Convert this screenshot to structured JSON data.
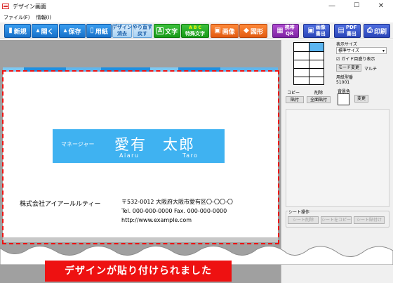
{
  "window": {
    "title": "デザイン画面",
    "minimize": "—",
    "maximize": "☐",
    "close": "✕"
  },
  "menu": [
    "ファイル(F)",
    "情報(I)"
  ],
  "toolbar": {
    "new": "新規",
    "open": "開く",
    "save": "保存",
    "paper": "用紙",
    "design_clear": [
      "デザイン",
      "消去"
    ],
    "undo_redo": [
      "やり直す",
      "戻す"
    ],
    "text": "文字",
    "special_text": [
      "特殊文字"
    ],
    "image": "画像",
    "shape": "図形",
    "mobile_qr": [
      "携帯",
      "QR"
    ],
    "image_out": [
      "画像",
      "書出"
    ],
    "pdf_out": [
      "PDF",
      "書出"
    ],
    "print": "印刷"
  },
  "card": {
    "role": "マネージャー",
    "name": "愛有　太郎",
    "romaji_first": "Aiaru",
    "romaji_last": "Taro",
    "company": "株式会社アイアールルティー",
    "address": "〒532-0012  大阪府大阪市愛有区〇-〇〇-〇",
    "phone": "Tel. 000-000-0000  Fax. 000-000-0000",
    "url": "http://www.example.com"
  },
  "panel": {
    "display_size_label": "表示サイズ",
    "display_size_value": "標準サイズ",
    "guide_checkbox": "ガイド目盛り表示",
    "mode_button": "モード変更",
    "multi_label": "マルチ",
    "paper_number_label": "用紙型番",
    "paper_number_value": "51001",
    "copy": "コピー",
    "delete": "削除",
    "paste": "貼付",
    "paste_all": "全面貼付",
    "bg_color_label": "背景色",
    "change": "変更",
    "sheet_ops_label": "シート操作",
    "sheet_delete": "シート削除",
    "sheet_copy": "シートをコピー",
    "sheet_paste": "シート貼付け"
  },
  "status_message": "デザインが貼り付けられました",
  "colors": {
    "accent_red": "#ee1111",
    "name_bg": "#3fb2f1",
    "toolbar_blue": "#1770c9"
  }
}
